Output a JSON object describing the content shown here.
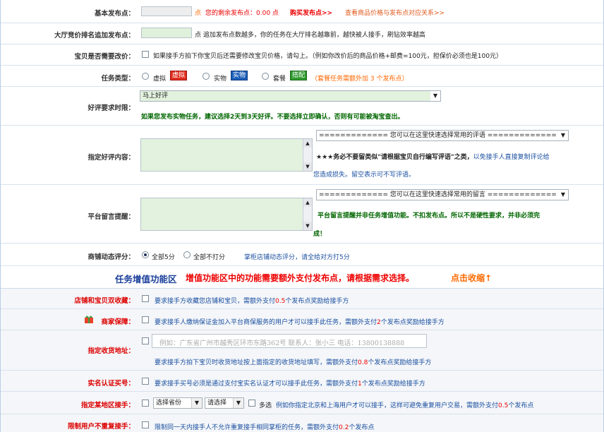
{
  "basic": {
    "label": "基本发布点：",
    "unit": "点",
    "remain_prefix": "您的剩余发布点：",
    "remain_value": "0.00",
    "remain_unit": "点",
    "buy_link": "购买发布点>>",
    "price_link": "查看商品价格与发布点对应关系>>"
  },
  "bid": {
    "label": "大厅竞价排名追加发布点：",
    "text": "点 追加发布点数越多，你的任务在大厅排名越靠前，越快被人接手，刷钻效率越高"
  },
  "price_change": {
    "label": "宝贝是否需要改价：",
    "text": "如果接手方拍下你宝贝后还需要修改宝贝价格，请勾上。（例如你改价后的商品价格+邮费=100元，担保价必须也是100元）"
  },
  "task_type": {
    "label": "任务类型：",
    "options": [
      {
        "label": "虚拟",
        "tag": "虚拟",
        "color": "#e03020"
      },
      {
        "label": "实物",
        "tag": "实物",
        "color": "#1d5fb8"
      },
      {
        "label": "套餐",
        "tag": "搭配",
        "color": "#2e9a2e"
      }
    ],
    "note": "（套餐任务需额外加 3 个发布点）"
  },
  "review_time": {
    "label": "好评要求时限：",
    "selected": "马上好评",
    "note": "如果您发布实物任务，建议选择2天到3天好评。不要选择立即确认，否则有可能被淘宝查出。"
  },
  "review_content": {
    "label": "指定好评内容：",
    "dropdown": "============= 您可以在这里快速选择常用的评语 =============",
    "warn_stars": "★★★",
    "warn_bold": "务必不要留类似\"请根据宝贝自行编写评语\"之类，",
    "warn_rest": "以免接手人直接复制评论给",
    "warn_line2": "您造成损失。留空表示可不写评语。"
  },
  "platform_msg": {
    "label": "平台留言提醒：",
    "dropdown": "============= 您可以在这里快速选择常用的留言 =============",
    "note_line1": "平台留言提醒并非任务增值功能。不扣发布点。所以不是硬性要求，并非必须完",
    "note_line2": "成！"
  },
  "shop_rating": {
    "label": "商铺动态评分：",
    "opt1": "全部5分",
    "opt2": "全部不打分",
    "note": "掌柜店铺动态评分，请全给对方打5分"
  },
  "vas": {
    "title": "任务增值功能区",
    "desc": "增值功能区中的功能需要额外支付发布点，请根据需求选择。",
    "toggle": "点击收缩↑"
  },
  "collect": {
    "label": "店铺和宝贝双收藏：",
    "pre": "要求接手方收藏您店铺和宝贝，需额外支付",
    "num": "0.5",
    "post": "个发布点奖励给接手方"
  },
  "guarantee": {
    "label": "商家保障：",
    "pre": "要求接手人缴纳保证金加入平台商保服务的用户才可以接手此任务，需额外支付",
    "num": "2",
    "post": "个发布点奖励给接手方"
  },
  "address": {
    "label": "指定收货地址：",
    "placeholder": "例如：广东省广州市越秀区环市东路362号     联系人：张小三     电话：13800138888",
    "pre": "要求接手方拍下宝贝时收货地址按上面指定的收货地址填写，需额外支付",
    "num": "0.8",
    "post": "个发布点奖励给接手方"
  },
  "realname": {
    "label": "实名认证买号：",
    "pre": "要求接手买号必须是通过支付宝实名认证才可以接手此任务，需额外支付",
    "num": "1",
    "post": "个发布点奖励给接手方"
  },
  "region": {
    "label": "指定某地区接手：",
    "province": "选择省份",
    "city": "请选择",
    "multi": "多选",
    "pre": "例如你指定北京和上海用户才可以接手，这样可避免重复用户交易，需额外支付",
    "num": "0.5",
    "post": "个发布点"
  },
  "limit": {
    "label": "限制用户不重复接手：",
    "pre": "限制同一天内接手人不允许重复接手相同掌柜的任务，需额外支付",
    "num": "0.2",
    "post": "个发布点"
  }
}
